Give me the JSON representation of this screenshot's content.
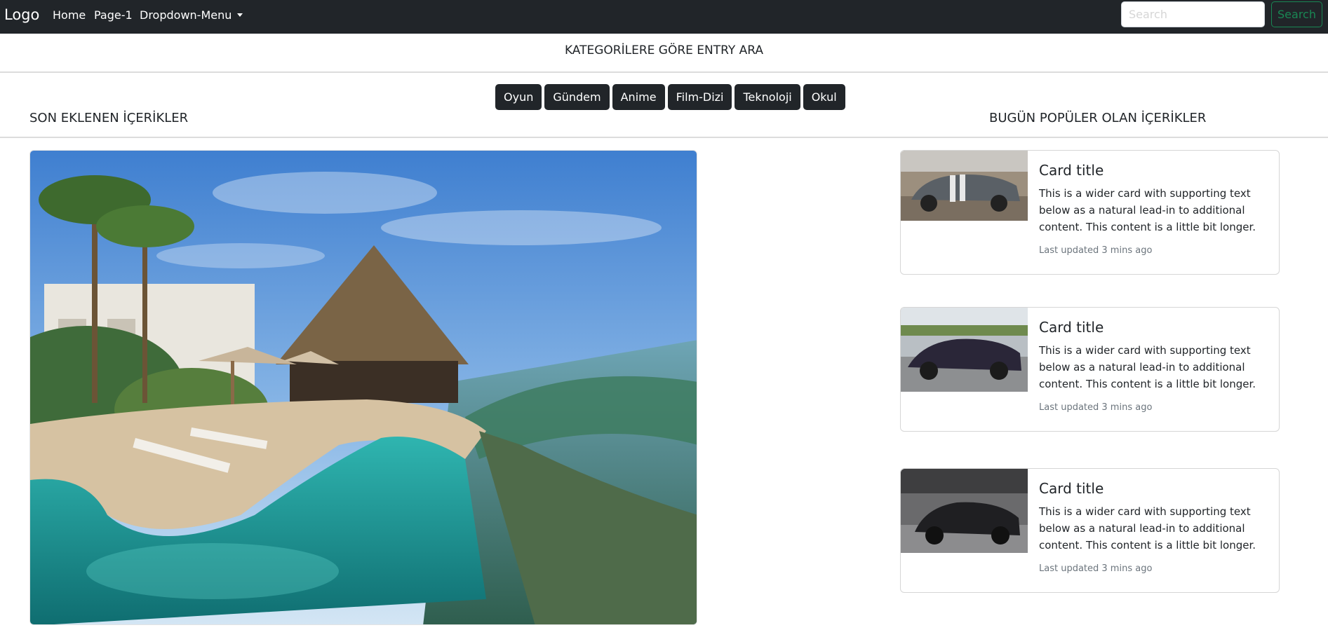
{
  "navbar": {
    "brand": "Logo",
    "links": [
      "Home",
      "Page-1",
      "Dropdown-Menu"
    ],
    "search_placeholder": "Search",
    "search_button": "Search"
  },
  "categories": {
    "heading": "KATEGORİLERE GÖRE ENTRY ARA",
    "buttons": [
      "Oyun",
      "Gündem",
      "Anime",
      "Film-Dizi",
      "Teknoloji",
      "Okul"
    ]
  },
  "sections": {
    "latest": "SON EKLENEN İÇERİKLER",
    "popular": "BUGÜN POPÜLER OLAN İÇERİKLER"
  },
  "cards": [
    {
      "title": "Card title",
      "text": "This is a wider card with supporting text below as a natural lead-in to additional content. This content is a little bit longer.",
      "updated": "Last updated 3 mins ago"
    },
    {
      "title": "Card title",
      "text": "This is a wider card with supporting text below as a natural lead-in to additional content. This content is a little bit longer.",
      "updated": "Last updated 3 mins ago"
    },
    {
      "title": "Card title",
      "text": "This is a wider card with supporting text below as a natural lead-in to additional content. This content is a little bit longer.",
      "updated": "Last updated 3 mins ago"
    }
  ],
  "colors": {
    "navbar_bg": "#212529",
    "success": "#198754",
    "button_dark": "#212529",
    "muted": "#6c757d"
  }
}
